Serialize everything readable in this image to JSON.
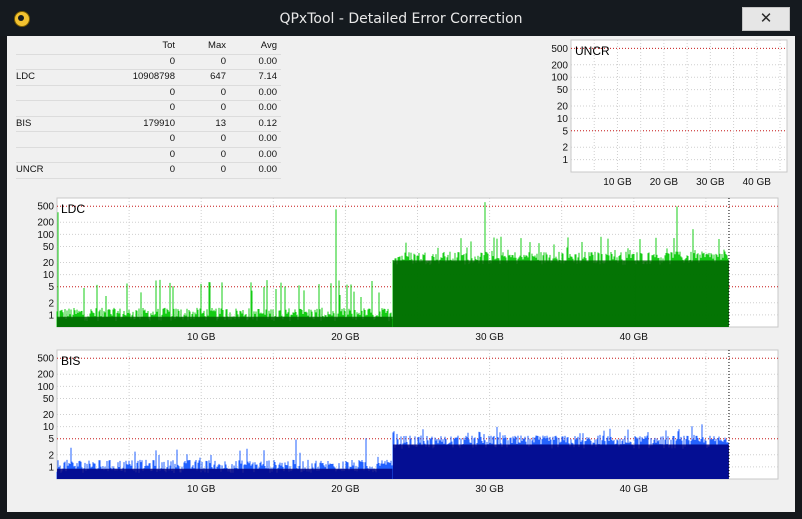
{
  "window": {
    "title": "QPxTool - Detailed Error Correction",
    "close_label": "✕"
  },
  "stats": {
    "headers": {
      "label": "",
      "tot": "Tot",
      "max": "Max",
      "avg": "Avg"
    },
    "rows": [
      {
        "label": "",
        "tot": "0",
        "max": "0",
        "avg": "0.00"
      },
      {
        "label": "LDC",
        "tot": "10908798",
        "max": "647",
        "avg": "7.14"
      },
      {
        "label": "",
        "tot": "0",
        "max": "0",
        "avg": "0.00"
      },
      {
        "label": "",
        "tot": "0",
        "max": "0",
        "avg": "0.00"
      },
      {
        "label": "BIS",
        "tot": "179910",
        "max": "13",
        "avg": "0.12"
      },
      {
        "label": "",
        "tot": "0",
        "max": "0",
        "avg": "0.00"
      },
      {
        "label": "",
        "tot": "0",
        "max": "0",
        "avg": "0.00"
      },
      {
        "label": "UNCR",
        "tot": "0",
        "max": "0",
        "avg": "0.00"
      }
    ]
  },
  "chart_data": [
    {
      "type": "bar",
      "title": "UNCR",
      "scale": "log",
      "yticks": [
        500,
        200,
        100,
        50,
        20,
        10,
        5,
        2,
        1
      ],
      "xticks": [
        "10 GB",
        "20 GB",
        "30 GB",
        "40 GB"
      ],
      "xlim": [
        0,
        46.5
      ],
      "ylim": [
        0.5,
        800
      ],
      "threshold_lines": [
        500,
        5
      ],
      "series": [
        {
          "values": [
            0
          ],
          "color": "#0000ff"
        }
      ]
    },
    {
      "type": "bar",
      "title": "LDC",
      "scale": "log",
      "yticks": [
        500,
        200,
        100,
        50,
        20,
        10,
        5,
        2,
        1
      ],
      "xticks": [
        "10 GB",
        "20 GB",
        "30 GB",
        "40 GB"
      ],
      "xlim": [
        0,
        50
      ],
      "ylim": [
        0.5,
        800
      ],
      "threshold_lines": [
        500,
        5
      ],
      "disc_end_gb": 46.6,
      "segments": [
        {
          "from": 0,
          "to": 23.3,
          "baseline": 1,
          "typical_peak": 5,
          "max_peak": 500
        },
        {
          "from": 23.3,
          "to": 46.6,
          "baseline": 25,
          "typical_peak": 60,
          "max_peak": 647
        }
      ],
      "colors": {
        "light": "#14cc14",
        "dark": "#006400"
      }
    },
    {
      "type": "bar",
      "title": "BIS",
      "scale": "log",
      "yticks": [
        500,
        200,
        100,
        50,
        20,
        10,
        5,
        2,
        1
      ],
      "xticks": [
        "10 GB",
        "20 GB",
        "30 GB",
        "40 GB"
      ],
      "xlim": [
        0,
        50
      ],
      "ylim": [
        0.5,
        800
      ],
      "threshold_lines": [
        500,
        5
      ],
      "disc_end_gb": 46.6,
      "segments": [
        {
          "from": 0,
          "to": 23.3,
          "baseline": 1,
          "typical_peak": 2,
          "max_peak": 7
        },
        {
          "from": 23.3,
          "to": 46.6,
          "baseline": 4,
          "typical_peak": 6,
          "max_peak": 13
        }
      ],
      "colors": {
        "light": "#2060ff",
        "dark": "#000080"
      }
    }
  ]
}
